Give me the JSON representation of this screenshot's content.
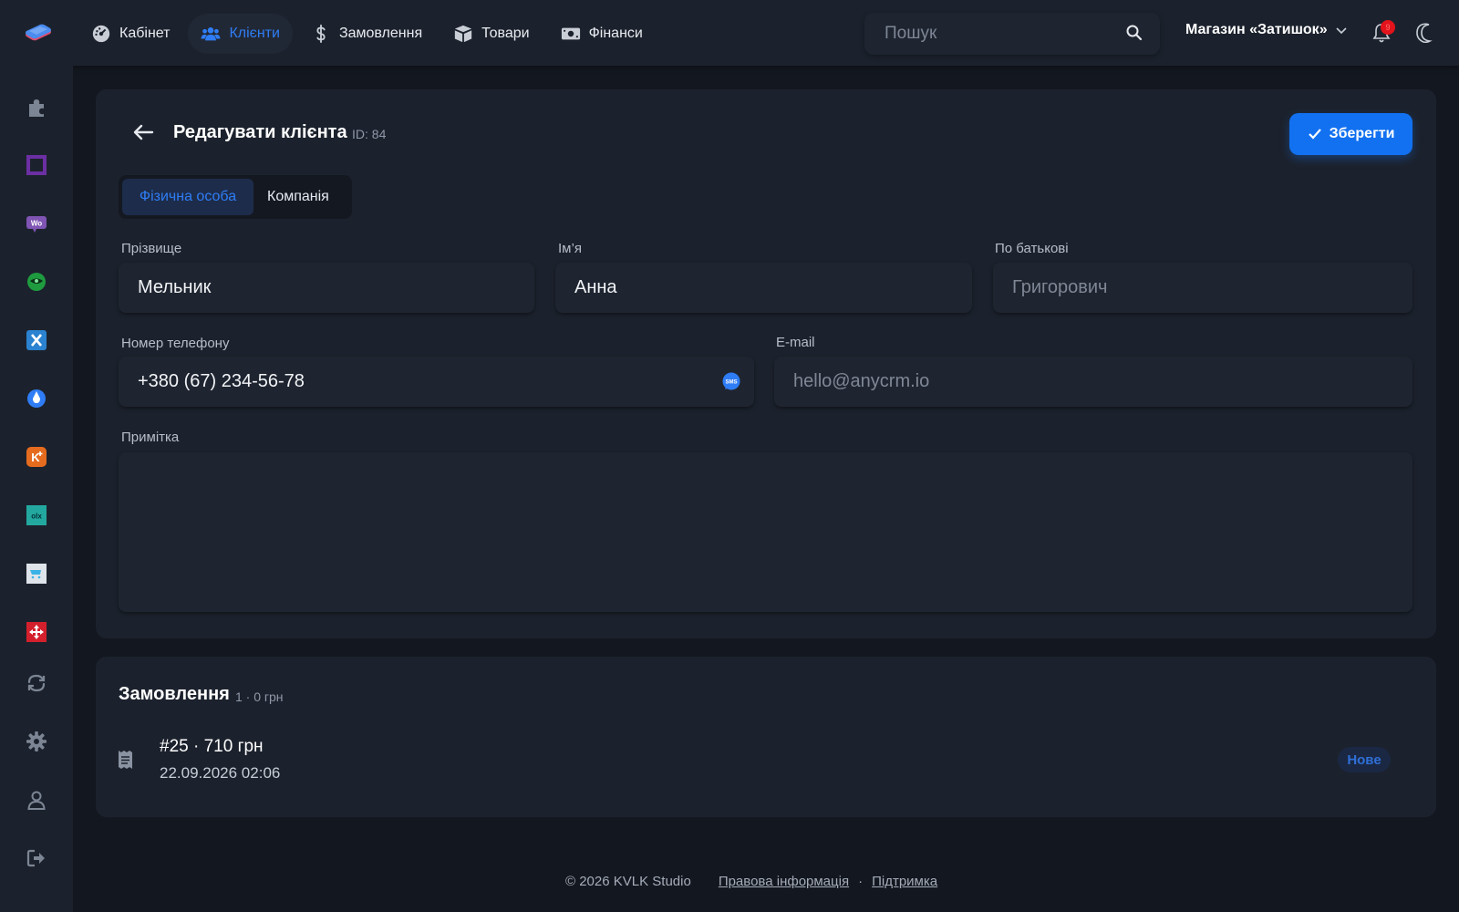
{
  "nav": {
    "items": [
      {
        "label": "Кабінет",
        "icon": "dashboard-icon"
      },
      {
        "label": "Клієнти",
        "icon": "users-icon"
      },
      {
        "label": "Замовлення",
        "icon": "dollar-icon"
      },
      {
        "label": "Товари",
        "icon": "box-icon"
      },
      {
        "label": "Фінанси",
        "icon": "money-icon"
      }
    ],
    "active": "Клієнти"
  },
  "search": {
    "placeholder": "Пошук"
  },
  "store": {
    "name": "Магазин «Затишок»"
  },
  "notifications": {
    "count": "9"
  },
  "sidebar": {
    "icons": [
      "puzzle-icon",
      "integration-square-icon",
      "woocommerce-icon",
      "green-integration-icon",
      "x-integration-icon",
      "blue-drop-icon",
      "k-plus-icon",
      "olx-icon",
      "cart-integration-icon",
      "red-integration-icon",
      "sync-icon",
      "settings-icon",
      "user-icon",
      "logout-icon"
    ]
  },
  "form": {
    "title": "Редагувати клієнта",
    "id_label": "ID: 84",
    "save_label": "Зберегти",
    "tabs": [
      "Фізична особа",
      "Компанія"
    ],
    "active_tab": "Фізична особа",
    "last_name": {
      "label": "Прізвище",
      "value": "Мельник",
      "placeholder": ""
    },
    "first_name": {
      "label": "Ім’я",
      "value": "Анна",
      "placeholder": ""
    },
    "middle_name": {
      "label": "По батькові",
      "value": "",
      "placeholder": "Григорович"
    },
    "phone": {
      "label": "Номер телефону",
      "value": "+380 (67) 234-56-78"
    },
    "email": {
      "label": "E-mail",
      "value": "",
      "placeholder": "hello@anycrm.io"
    },
    "note": {
      "label": "Примітка",
      "value": ""
    }
  },
  "orders": {
    "title": "Замовлення",
    "meta": "1 · 0 грн",
    "items": [
      {
        "title": "#25 · 710 грн",
        "date": "22.09.2026 02:06",
        "status": "Нове"
      }
    ]
  },
  "footer": {
    "copyright": "© 2026 KVLK Studio",
    "legal": "Правова інформація",
    "separator": "·",
    "support": "Підтримка"
  },
  "colors": {
    "accent": "#1271f0",
    "background": "#13171f",
    "panel": "#1c222d",
    "field": "#1f2530"
  }
}
